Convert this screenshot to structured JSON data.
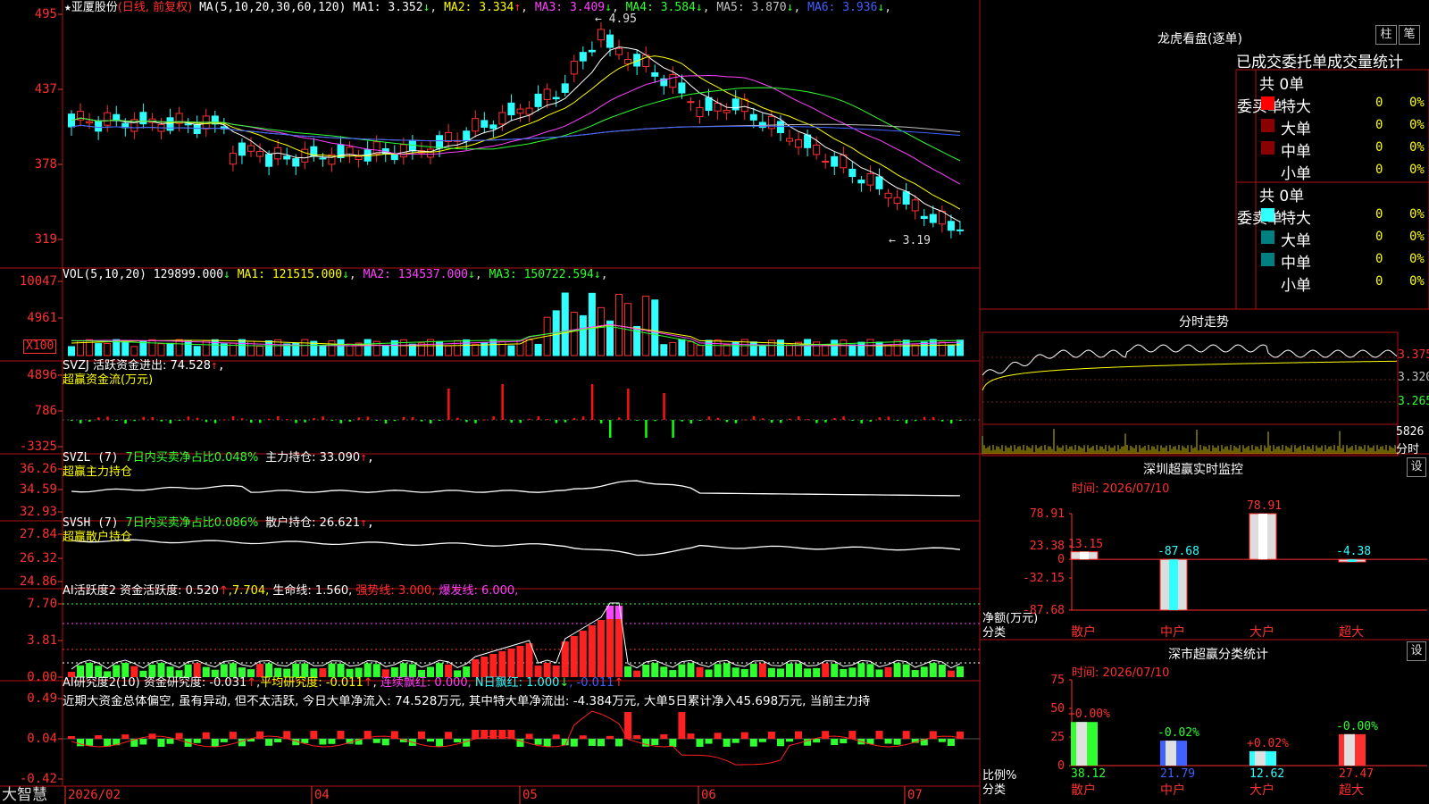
{
  "main": {
    "star": "★",
    "stock_name": "亚厦股份",
    "period": "(日线, 前复权)",
    "ma_prefix": "MA(5,10,20,30,60,120)",
    "ma_items": [
      {
        "label": "MA1: 3.352",
        "arrow": "↓",
        "color": "#ffffff"
      },
      {
        "label": "MA2: 3.334",
        "arrow": "↑",
        "color": "#ffff00"
      },
      {
        "label": "MA3: 3.409",
        "arrow": "↓",
        "color": "#ff40ff"
      },
      {
        "label": "MA4: 3.584",
        "arrow": "↓",
        "color": "#30ff30"
      },
      {
        "label": "MA5: 3.870",
        "arrow": "↓",
        "color": "#c0c0c0"
      },
      {
        "label": "MA6: 3.936",
        "arrow": "↓",
        "color": "#4060ff"
      }
    ],
    "y_ticks": [
      "495",
      "437",
      "378",
      "319"
    ],
    "high_label": "4.95",
    "low_label": "3.19"
  },
  "vol": {
    "header": "VOL(5,10,20)",
    "value": "129899.000",
    "arrow": "↓",
    "items": [
      {
        "label": "MA1: 121515.000",
        "arrow": "↓",
        "color": "#ffff00"
      },
      {
        "label": "MA2: 134537.000",
        "arrow": "↓",
        "color": "#ff40ff"
      },
      {
        "label": "MA3: 150722.594",
        "arrow": "↓",
        "color": "#30ff30"
      }
    ],
    "y_ticks": [
      "10047",
      "4961"
    ],
    "unit": "X100"
  },
  "svzj": {
    "line1": "SVZJ  活跃资金进出: 74.528",
    "arrow": "↑",
    "line2": "超赢资金流(万元)",
    "y_ticks": [
      "4896",
      "786",
      "-3325"
    ]
  },
  "svzl": {
    "prefix": "SVZL (7)",
    "ratio": "7日内买卖净占比0.048%",
    "hold": "主力持仓: 33.090",
    "arrow": "↑",
    "line2": "超赢主力持仓",
    "y_ticks": [
      "36.26",
      "34.59",
      "32.93"
    ]
  },
  "svsh": {
    "prefix": "SVSH (7)",
    "ratio": "7日内买卖净占比0.086%",
    "hold": "散户持仓: 26.621",
    "arrow": "↑",
    "line2": "超赢散户持仓",
    "y_ticks": [
      "27.84",
      "26.32",
      "24.86"
    ]
  },
  "ai_activity": {
    "name": "AI活跃度2",
    "label1": "资金活跃度: 0.520",
    "arrow1": "↑",
    "label2": ",7.704,",
    "label3": "生命线: 1.560,",
    "label4": "强势线: 3.000,",
    "label5": "爆发线: 6.000,",
    "y_ticks": [
      "7.70",
      "3.81",
      "0.00"
    ]
  },
  "ai_research": {
    "name": "AI研究度2(10)",
    "label1": "资金研究度: -0.031",
    "arrow1": "↑",
    "label2": "平均研究度: -0.011",
    "arrow2": "↑",
    "label3": "连续飘红: 0.000,",
    "label4": "N日飘红: 1.000",
    "arrow4": "↓",
    "label5": ", -0.011",
    "arrow5": "↑",
    "comment": "近期大资金总体偏空, 虽有异动, 但不太活跃, 今日大单净流入: 74.528万元, 其中特大单净流出: -4.384万元, 大单5日累计净入45.698万元, 当前主力持",
    "y_ticks": [
      "0.49",
      "0.04",
      "-0.42"
    ]
  },
  "footer": {
    "brand": "大智慧",
    "dates": [
      "2026/02",
      "04",
      "05",
      "06",
      "07"
    ]
  },
  "dragon": {
    "title": "龙虎看盘(逐单)",
    "btn_bar": "柱",
    "btn_pen": "笔",
    "tabs": [
      "已成交",
      "委托单",
      "成交量统计"
    ],
    "buy_label": "委买单",
    "sell_label": "委卖单",
    "buy_total": "共 0单",
    "sell_total": "共 0单",
    "rows": [
      {
        "name": "特大",
        "count": "0",
        "pct": "0%"
      },
      {
        "name": "大单",
        "count": "0",
        "pct": "0%"
      },
      {
        "name": "中单",
        "count": "0",
        "pct": "0%"
      },
      {
        "name": "小单",
        "count": "0",
        "pct": "0%"
      }
    ],
    "buy_colors": [
      "#ff0000",
      "#8b0000",
      "#8b0000",
      "#000000"
    ],
    "sell_colors": [
      "#30ffff",
      "#008080",
      "#008080",
      "#000000"
    ]
  },
  "intraday": {
    "title": "分时走势",
    "prices": [
      "3.375",
      "3.320",
      "3.265"
    ],
    "volume": "5826",
    "vol_label": "分时"
  },
  "sz_monitor": {
    "title": "深圳超赢实时监控",
    "setting": "设",
    "time_label": "时间: 2026/07/10",
    "y_ticks": [
      "78.91",
      "23.38",
      "0",
      "-32.15",
      "-87.68"
    ],
    "y_caption": "净额(万元)",
    "x_caption": "分类",
    "chart_data": {
      "type": "bar",
      "categories": [
        "散户",
        "中户",
        "大户",
        "超大"
      ],
      "values": [
        13.15,
        -87.68,
        78.91,
        -4.38
      ],
      "labels": [
        "13.15",
        "-87.68",
        "78.91",
        "-4.38"
      ]
    }
  },
  "sz_class": {
    "title": "深市超赢分类统计",
    "setting": "设",
    "time_label": "时间: 2026/07/10",
    "y_ticks": [
      "75",
      "50",
      "25",
      "0"
    ],
    "y_caption": "比例%",
    "x_caption": "分类",
    "chart_data": {
      "type": "bar",
      "categories": [
        "散户",
        "中户",
        "大户",
        "超大"
      ],
      "values": [
        38.12,
        21.79,
        12.62,
        27.47
      ],
      "change_labels": [
        "+0.00%",
        "-0.02%",
        "+0.02%",
        "-0.00%"
      ],
      "value_labels": [
        "38.12",
        "21.79",
        "12.62",
        "27.47"
      ],
      "colors": [
        "#30ff30",
        "#4060ff",
        "#30ffff",
        "#ff3030"
      ]
    }
  }
}
